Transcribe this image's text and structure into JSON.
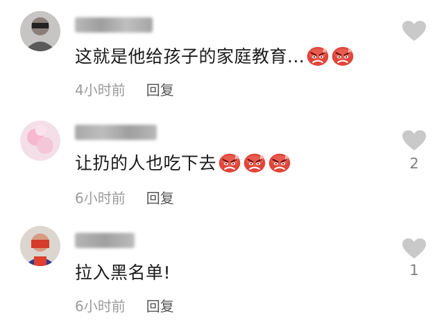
{
  "comments": [
    {
      "username": "■■■■■■",
      "text": "这就是他给孩子的家庭教育...",
      "emoji_count": 2,
      "time": "4小时前",
      "reply_label": "回复",
      "likes": ""
    },
    {
      "username": "■■■■■■",
      "text": "让扔的人也吃下去",
      "emoji_count": 3,
      "time": "6小时前",
      "reply_label": "回复",
      "likes": "2"
    },
    {
      "username": "■■■■",
      "text": "拉入黑名单!",
      "emoji_count": 0,
      "time": "6小时前",
      "reply_label": "回复",
      "likes": "1"
    }
  ],
  "emoji_icon": "angry-face-emoji",
  "colors": {
    "heart": "#c9c9c9",
    "emoji": "#e0453a",
    "meta": "#9a9a9a"
  }
}
